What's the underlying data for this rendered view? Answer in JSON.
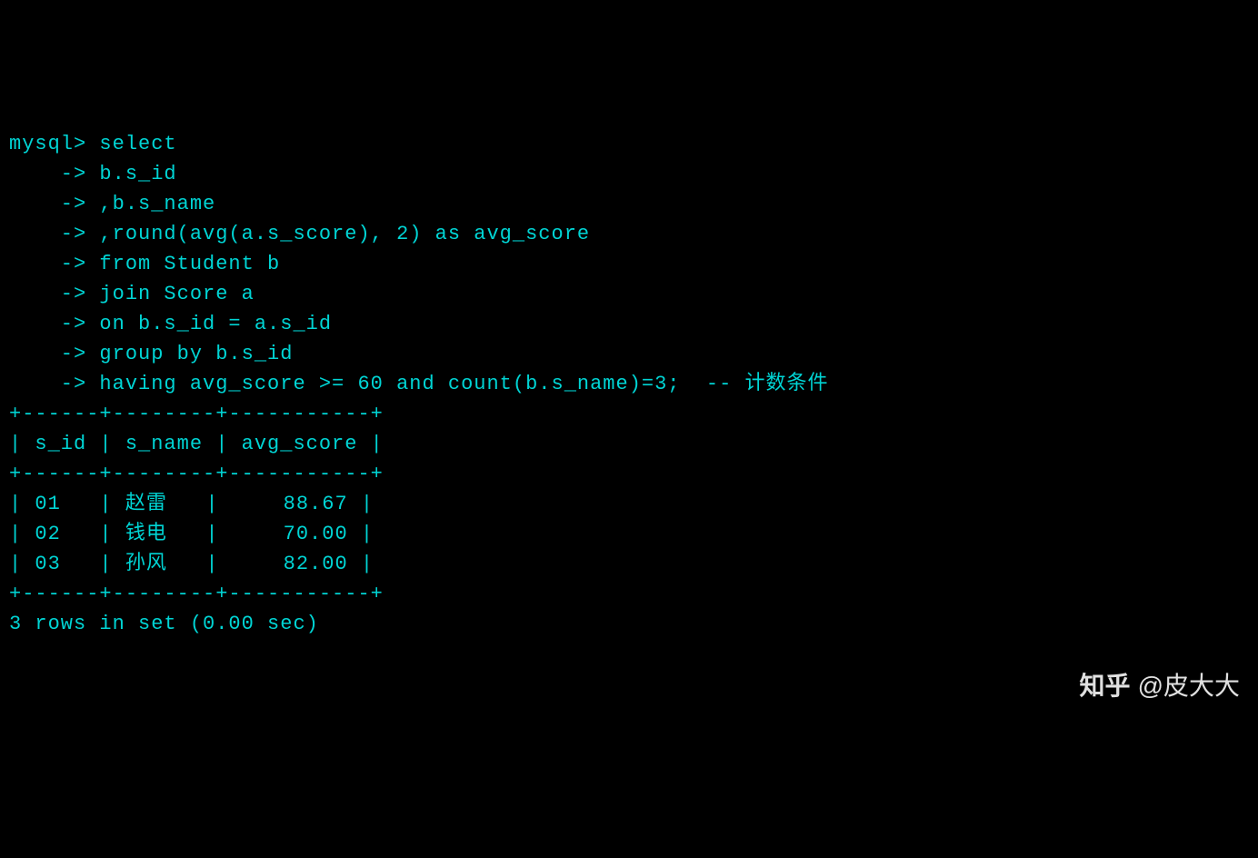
{
  "terminal": {
    "prompt": "mysql>",
    "continuation": "    ->",
    "query_lines": [
      "mysql> select",
      "    -> b.s_id",
      "    -> ,b.s_name",
      "    -> ,round(avg(a.s_score), 2) as avg_score",
      "    -> from Student b",
      "    -> join Score a",
      "    -> on b.s_id = a.s_id",
      "    -> group by b.s_id",
      "    -> having avg_score >= 60 and count(b.s_name)=3;  -- 计数条件"
    ],
    "table_border": "+------+--------+-----------+",
    "table_header": "| s_id | s_name | avg_score |",
    "table_rows": [
      "| 01   | 赵雷   |     88.67 |",
      "| 02   | 钱电   |     70.00 |",
      "| 03   | 孙风   |     82.00 |"
    ],
    "result_footer": "3 rows in set (0.00 sec)"
  },
  "watermark": {
    "logo": "知乎",
    "author": "@皮大大"
  }
}
